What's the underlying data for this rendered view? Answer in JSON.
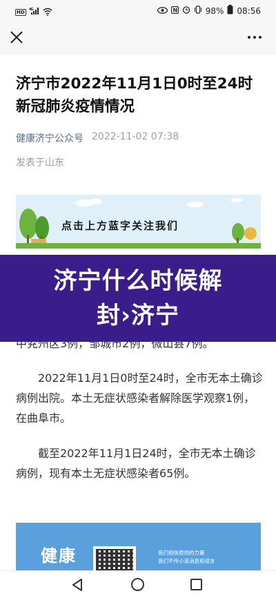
{
  "status_bar": {
    "left_icons": [
      "hd-icon",
      "signal-icon",
      "wifi-icon"
    ],
    "signal_text": "4G",
    "hd_text": "HD",
    "right_icons": [
      "eye-icon",
      "nfc-icon",
      "alarm-icon",
      "vibrate-icon"
    ],
    "battery": "98%",
    "time": "08:56"
  },
  "nav": {
    "close_icon": "close-icon",
    "more_icon": "more-icon"
  },
  "article": {
    "title": "济宁市2022年11月1日0时至24时新冠肺炎疫情情况",
    "account": "健康济宁公众号",
    "date": "2022-11-02 07:38",
    "location": "发表于山东"
  },
  "follow_banner": {
    "text": "点击上方蓝字关注我们"
  },
  "overlay": {
    "headline": "济宁什么时候解封›济宁"
  },
  "body": {
    "partial_line": "中兖州区3例，邹城市2例，微山县7例。",
    "paragraphs": [
      "2022年11月1日0时至24时，全市无本土确诊病例出院。本土无症状感染者解除医学观察1例，在曲阜市。",
      "截至2022年11月1日24时，全市无本土确诊病例，现有本土无症状感染者65例。"
    ]
  },
  "health_card": {
    "brand": "健康",
    "line1": "我们相信原创的力量",
    "line2": "我们不传小道消息和谣言"
  },
  "colors": {
    "overlay": "#3a1d8a",
    "account_link": "#576b95",
    "banner_bg": "#dff0f8",
    "card_bg": "#5aa0dc"
  }
}
